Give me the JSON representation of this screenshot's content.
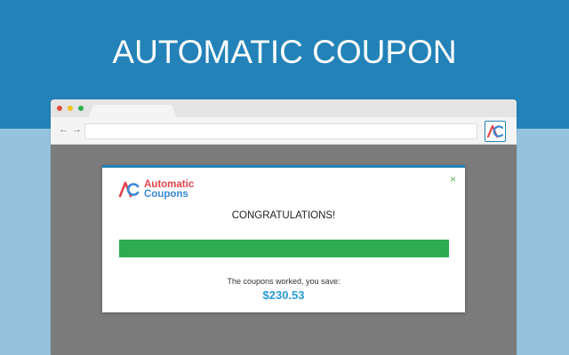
{
  "banner": {
    "headline": "AUTOMATIC COUPON",
    "background_color": "#2382b8",
    "lower_background_color": "#95c3de"
  },
  "browser": {
    "window_dots": [
      "red-dot",
      "yellow-dot",
      "green-dot"
    ],
    "nav": {
      "back_icon": "←",
      "forward_icon": "→"
    },
    "address_value": "",
    "extension_icon": "automatic-coupons-extension-icon"
  },
  "popup": {
    "brand": {
      "line1": "Automatic",
      "line2": "Coupons"
    },
    "close_icon": "×",
    "heading": "CONGRATULATIONS!",
    "progress": {
      "value": 1.0,
      "color": "#2eac4f"
    },
    "savings_label": "The coupons worked, you save:",
    "savings_amount": "$230.53",
    "accent_color": "#2382b8"
  }
}
